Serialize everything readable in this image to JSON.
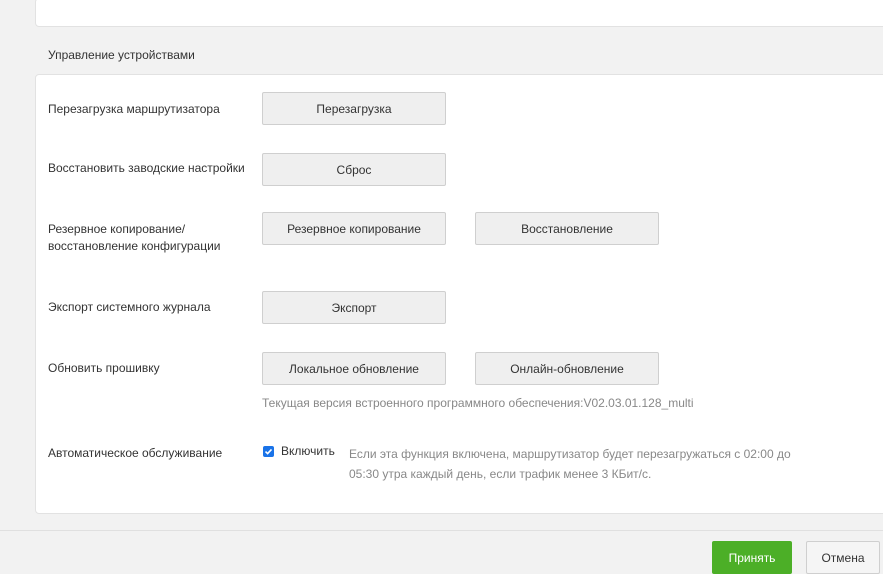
{
  "section": {
    "title": "Управление устройствами"
  },
  "rows": {
    "reboot": {
      "label": "Перезагрузка маршрутизатора",
      "button": "Перезагрузка"
    },
    "reset": {
      "label": "Восстановить заводские настройки",
      "button": "Сброс"
    },
    "backup": {
      "label": "Резервное копирование/ восстановление конфигурации",
      "backup_button": "Резервное копирование",
      "restore_button": "Восстановление"
    },
    "export": {
      "label": "Экспорт системного журнала",
      "button": "Экспорт"
    },
    "firmware": {
      "label": "Обновить прошивку",
      "local_button": "Локальное обновление",
      "online_button": "Онлайн-обновление",
      "version_text": "Текущая версия встроенного программного обеспечения:V02.03.01.128_multi"
    },
    "auto": {
      "label": "Автоматическое обслуживание",
      "enable_label": "Включить",
      "checked": true,
      "description": "Если эта функция включена, маршрутизатор будет перезагружаться с 02:00 до 05:30 утра каждый день, если трафик менее 3 КБит/с."
    }
  },
  "footer": {
    "apply_label": "Принять",
    "cancel_label": "Отмена"
  },
  "colors": {
    "apply": "#4caf27",
    "checkbox": "#1a73e8",
    "background": "#f2f2f2"
  }
}
